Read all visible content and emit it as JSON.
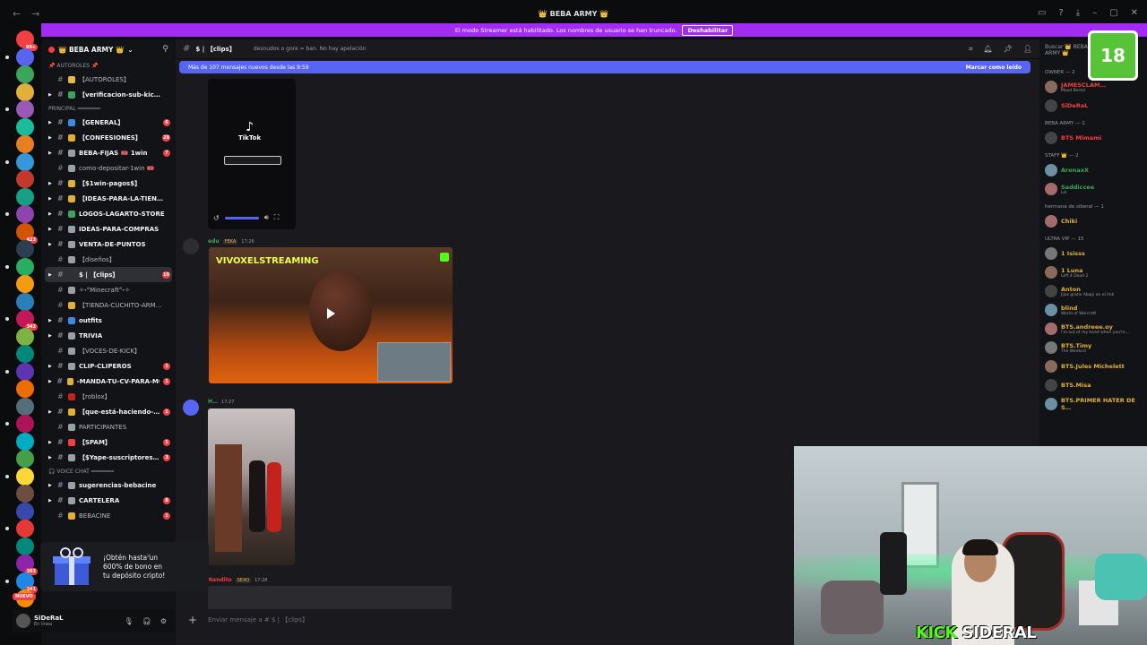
{
  "window": {
    "title": "👑 BEBA ARMY 👑"
  },
  "banner": {
    "text": "El modo Streamer está habilitado. Los nombres de usuario se han truncado.",
    "button": "Deshabilitar"
  },
  "server": {
    "name": "👑 BEBA ARMY 👑"
  },
  "channels": [
    {
      "type": "cat",
      "label": "📌 AUTOROLES 📌"
    },
    {
      "type": "ch",
      "label": "【AUTOROLES】",
      "color": "#e8b84a"
    },
    {
      "type": "ch",
      "label": "【verificacion-sub-kic…",
      "bold": true,
      "color": "#3ba55c"
    },
    {
      "type": "cat",
      "label": "PRINCIPAL ━━━━━━━"
    },
    {
      "type": "ch",
      "label": "【GENERAL】",
      "bold": true,
      "count": "6",
      "color": "#3b8ae0"
    },
    {
      "type": "ch",
      "label": "【CONFESIONES】",
      "bold": true,
      "count": "28",
      "color": "#e0b03b"
    },
    {
      "type": "ch",
      "label": "BEBA-FIJAS 🎟️ 1win",
      "bold": true,
      "count": "7",
      "color": "#9aa0a6"
    },
    {
      "type": "ch",
      "label": "como-depositar-1win 🎟️",
      "color": "#9aa0a6"
    },
    {
      "type": "ch",
      "label": "【$1win-pagos$】",
      "bold": true,
      "color": "#e0b03b"
    },
    {
      "type": "ch",
      "label": "【IDEAS-PARA-LA-TIEN…",
      "bold": true,
      "color": "#e0b03b"
    },
    {
      "type": "ch",
      "label": "LOGOS-LAGARTO-STORE",
      "bold": true,
      "color": "#3ba55c"
    },
    {
      "type": "ch",
      "label": "IDEAS-PARA-COMPRAS",
      "bold": true,
      "color": "#9aa0a6"
    },
    {
      "type": "ch",
      "label": "VENTA-DE-PUNTOS",
      "bold": true,
      "color": "#9aa0a6"
    },
    {
      "type": "ch",
      "label": "【diseños】",
      "color": "#9aa0a6"
    },
    {
      "type": "ch",
      "label": "$ | 【clips】",
      "bold": true,
      "selected": true,
      "count": "10",
      "color": "#2e3035"
    },
    {
      "type": "ch",
      "label": "✧˖°Minecraft°˖✧",
      "color": "#9aa0a6"
    },
    {
      "type": "ch",
      "label": "【TIENDA-CUCHITO-ARM…",
      "color": "#e0b03b"
    },
    {
      "type": "ch",
      "label": "outfits",
      "bold": true,
      "color": "#3b8ae0"
    },
    {
      "type": "ch",
      "label": "TRIVIA",
      "bold": true,
      "color": "#9aa0a6"
    },
    {
      "type": "ch",
      "label": "【VOCES-DE-KICK】",
      "color": "#9aa0a6"
    },
    {
      "type": "ch",
      "label": "CLIP-CLIPEROS",
      "bold": true,
      "count": "1",
      "color": "#9aa0a6"
    },
    {
      "type": "ch",
      "label": "-MANDA-TU-CV-PARA-MOD",
      "bold": true,
      "count": "1",
      "color": "#e0b03b"
    },
    {
      "type": "ch",
      "label": "【roblox】",
      "color": "#c4221c"
    },
    {
      "type": "ch",
      "label": "【que-está-haciendo-…",
      "bold": true,
      "count": "1",
      "color": "#e0b03b"
    },
    {
      "type": "ch",
      "label": "PARTICIPANTES",
      "color": "#9aa0a6"
    },
    {
      "type": "ch",
      "label": "【SPAM】",
      "bold": true,
      "count": "1",
      "color": "#f23f43"
    },
    {
      "type": "ch",
      "label": "【$Yape-suscriptores…",
      "bold": true,
      "count": "3",
      "color": "#9aa0a6"
    },
    {
      "type": "cat",
      "label": "🎧 VOICE CHAT ━━━━━━━"
    },
    {
      "type": "ch",
      "label": "sugerencias-bebacine",
      "bold": true,
      "color": "#9aa0a6"
    },
    {
      "type": "ch",
      "label": "CARTELERA",
      "bold": true,
      "count": "8",
      "color": "#9aa0a6"
    },
    {
      "type": "ch",
      "label": "BEBACINE",
      "count": "1",
      "color": "#e0b03b"
    }
  ],
  "channel_header": {
    "name": "$ | 【clips】",
    "topic": "desnudos o gore = ban. No hay apelación"
  },
  "new_messages": {
    "text": "Más de 107 mensajes nuevos desde las 9:59",
    "action": "Marcar como leído"
  },
  "tiktok": {
    "logo": "TikTok"
  },
  "messages": [
    {
      "user": "edu",
      "tag": "FEKA",
      "time": "17:26",
      "embed_label": "VIVOXELSTREAMING"
    },
    {
      "user": "H…",
      "tag": "",
      "time": "17:27"
    },
    {
      "user": "Nandito",
      "tag": "SEXO",
      "time": "17:28"
    }
  ],
  "composer": {
    "placeholder": "Enviar mensaje a # $ | 【clips】"
  },
  "promo": {
    "text": "¡Obtén hasta un 600% de bono en tu depósito cripto!",
    "badge": "NUEVO"
  },
  "user": {
    "name": "SiDeRaL",
    "status": "En línea"
  },
  "members": {
    "search": "Buscar 👑 BEBA ARMY 👑",
    "groups": [
      {
        "label": "OWNER — 2",
        "items": [
          {
            "name": "JAMESCLAM…",
            "sub": "Mood Bored",
            "color": "#f23f43"
          },
          {
            "name": "SiDeRaL",
            "sub": "",
            "color": "#f23f43"
          }
        ]
      },
      {
        "label": "BEBA ARMY — 1",
        "items": [
          {
            "name": "BTS Mimami",
            "sub": "",
            "color": "#f23f43"
          }
        ]
      },
      {
        "label": "STAFF 👑 — 2",
        "items": [
          {
            "name": "AronaxX",
            "sub": "",
            "color": "#3ba55c"
          },
          {
            "name": "Saddiccee",
            "sub": "Lol",
            "color": "#3ba55c"
          }
        ]
      },
      {
        "label": "hermana de siberal — 1",
        "items": [
          {
            "name": "Chiki",
            "sub": "",
            "color": "#e0b03b"
          }
        ]
      },
      {
        "label": "ULTRA VIP — 15",
        "items": [
          {
            "name": "1 Isisss",
            "sub": "",
            "color": "#e0b03b"
          },
          {
            "name": "1 Luna",
            "sub": "Left 4 Dead 2",
            "color": "#e0b03b"
          },
          {
            "name": "Anton",
            "sub": "Jijas gratis Abajo en el link",
            "color": "#e0b03b"
          },
          {
            "name": "blind",
            "sub": "World of Warcraft",
            "color": "#e0b03b"
          },
          {
            "name": "BTS.andreee.oy",
            "sub": "I'm out of my head when you're…",
            "color": "#e0b03b"
          },
          {
            "name": "BTS.Timy",
            "sub": "The Weeknd",
            "color": "#e0b03b"
          },
          {
            "name": "BTS.Jules Michelett",
            "sub": "",
            "color": "#e0b03b"
          },
          {
            "name": "BTS.Misa",
            "sub": "",
            "color": "#e0b03b"
          },
          {
            "name": "BTS.PRIMER HATER DE S…",
            "sub": "",
            "color": "#e0b03b"
          }
        ]
      }
    ]
  },
  "age_badge": "18",
  "overlay_brand": {
    "prefix": "KICK",
    "name": "SIDERAL"
  },
  "server_badges": [
    "99+",
    "",
    "",
    "",
    "",
    "",
    "",
    "",
    "",
    "",
    "",
    "423",
    "",
    "",
    "",
    "",
    "342",
    "",
    "",
    "",
    "",
    "",
    "",
    "",
    "",
    "",
    "",
    "",
    "",
    "",
    "363",
    "241",
    ""
  ]
}
